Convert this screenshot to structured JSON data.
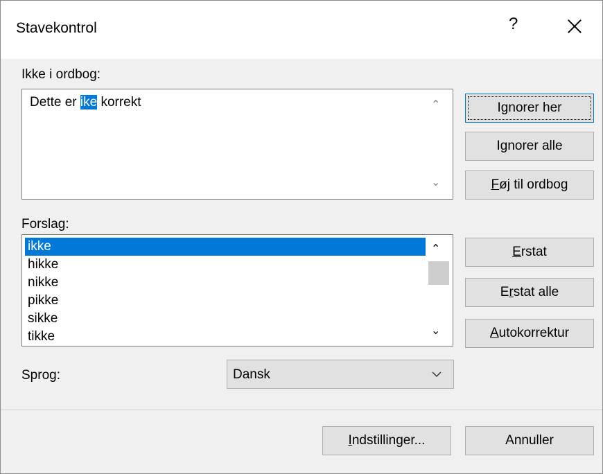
{
  "dialog": {
    "title": "Stavekontrol",
    "help_label": "?",
    "close_label": "×"
  },
  "not_in_dictionary": {
    "label": "Ikke i ordbog:",
    "text_before": "Dette er ",
    "highlighted_word": "ike",
    "text_after": " korrekt"
  },
  "suggestions": {
    "label": "Forslag:",
    "items": [
      "ikke",
      "hikke",
      "nikke",
      "pikke",
      "sikke",
      "tikke"
    ],
    "selected_index": 0
  },
  "language": {
    "label": "Sprog:",
    "value": "Dansk"
  },
  "buttons": {
    "ignore_once": {
      "pre": "I",
      "ul": "g",
      "post": "norer her"
    },
    "ignore_all": {
      "pre": "I",
      "ul": "g",
      "post": "norer alle",
      "_note": ""
    },
    "add_to_dictionary": {
      "pre": "",
      "ul": "F",
      "post": "øj til ordbog"
    },
    "change": {
      "pre": "",
      "ul": "E",
      "post": "rstat"
    },
    "change_all": {
      "pre": "E",
      "ul": "r",
      "post": "stat alle"
    },
    "autocorrect": {
      "pre": "",
      "ul": "A",
      "post": "utokorrektur"
    },
    "options": {
      "pre": "",
      "ul": "I",
      "post": "ndstillinger..."
    },
    "cancel": {
      "pre": "",
      "ul": "",
      "post": "Annuller"
    }
  },
  "colors": {
    "accent": "#0078d7",
    "window_bg": "#f0f0f0",
    "button_bg": "#e1e1e1"
  }
}
